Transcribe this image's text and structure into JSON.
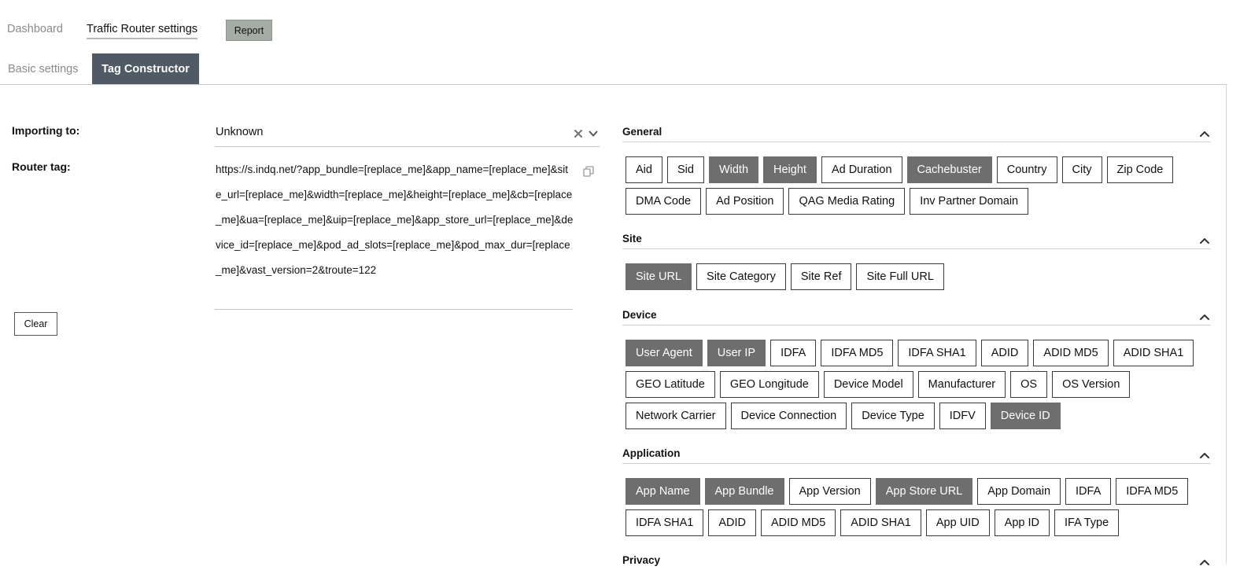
{
  "nav": {
    "dashboard": "Dashboard",
    "traffic_router_settings": "Traffic Router settings",
    "report": "Report"
  },
  "tabs": {
    "basic": "Basic settings",
    "tag_constructor": "Tag Constructor"
  },
  "form": {
    "importing_label": "Importing to:",
    "importing_value": "Unknown",
    "router_label": "Router tag:",
    "router_tag": "https://s.indq.net/?app_bundle=[replace_me]&app_name=[replace_me]&site_url=[replace_me]&width=[replace_me]&height=[replace_me]&cb=[replace_me]&ua=[replace_me]&uip=[replace_me]&app_store_url=[replace_me]&device_id=[replace_me]&pod_ad_slots=[replace_me]&pod_max_dur=[replace_me]&vast_version=2&troute=122",
    "clear": "Clear"
  },
  "sections": {
    "general": {
      "title": "General",
      "items": [
        {
          "label": "Aid",
          "selected": false
        },
        {
          "label": "Sid",
          "selected": false
        },
        {
          "label": "Width",
          "selected": true
        },
        {
          "label": "Height",
          "selected": true
        },
        {
          "label": "Ad Duration",
          "selected": false
        },
        {
          "label": "Cachebuster",
          "selected": true
        },
        {
          "label": "Country",
          "selected": false
        },
        {
          "label": "City",
          "selected": false
        },
        {
          "label": "Zip Code",
          "selected": false
        },
        {
          "label": "DMA Code",
          "selected": false
        },
        {
          "label": "Ad Position",
          "selected": false
        },
        {
          "label": "QAG Media Rating",
          "selected": false
        },
        {
          "label": "Inv Partner Domain",
          "selected": false
        }
      ]
    },
    "site": {
      "title": "Site",
      "items": [
        {
          "label": "Site URL",
          "selected": true
        },
        {
          "label": "Site Category",
          "selected": false
        },
        {
          "label": "Site Ref",
          "selected": false
        },
        {
          "label": "Site Full URL",
          "selected": false
        }
      ]
    },
    "device": {
      "title": "Device",
      "items": [
        {
          "label": "User Agent",
          "selected": true
        },
        {
          "label": "User IP",
          "selected": true
        },
        {
          "label": "IDFA",
          "selected": false
        },
        {
          "label": "IDFA MD5",
          "selected": false
        },
        {
          "label": "IDFA SHA1",
          "selected": false
        },
        {
          "label": "ADID",
          "selected": false
        },
        {
          "label": "ADID MD5",
          "selected": false
        },
        {
          "label": "ADID SHA1",
          "selected": false
        },
        {
          "label": "GEO Latitude",
          "selected": false
        },
        {
          "label": "GEO Longitude",
          "selected": false
        },
        {
          "label": "Device Model",
          "selected": false
        },
        {
          "label": "Manufacturer",
          "selected": false
        },
        {
          "label": "OS",
          "selected": false
        },
        {
          "label": "OS Version",
          "selected": false
        },
        {
          "label": "Network Carrier",
          "selected": false
        },
        {
          "label": "Device Connection",
          "selected": false
        },
        {
          "label": "Device Type",
          "selected": false
        },
        {
          "label": "IDFV",
          "selected": false
        },
        {
          "label": "Device ID",
          "selected": true
        }
      ]
    },
    "application": {
      "title": "Application",
      "items": [
        {
          "label": "App Name",
          "selected": true
        },
        {
          "label": "App Bundle",
          "selected": true
        },
        {
          "label": "App Version",
          "selected": false
        },
        {
          "label": "App Store URL",
          "selected": true
        },
        {
          "label": "App Domain",
          "selected": false
        },
        {
          "label": "IDFA",
          "selected": false
        },
        {
          "label": "IDFA MD5",
          "selected": false
        },
        {
          "label": "IDFA SHA1",
          "selected": false
        },
        {
          "label": "ADID",
          "selected": false
        },
        {
          "label": "ADID MD5",
          "selected": false
        },
        {
          "label": "ADID SHA1",
          "selected": false
        },
        {
          "label": "App UID",
          "selected": false
        },
        {
          "label": "App ID",
          "selected": false
        },
        {
          "label": "IFA Type",
          "selected": false
        }
      ]
    },
    "privacy": {
      "title": "Privacy"
    }
  },
  "icons": {
    "clear": "close-icon",
    "dropdown": "chevron-down-icon",
    "copy": "copy-icon",
    "collapse": "chevron-up-icon"
  },
  "colors": {
    "active_tab": "#4f5a64",
    "selected_chip": "#6e6e6e",
    "report_button": "#a5aba5"
  }
}
